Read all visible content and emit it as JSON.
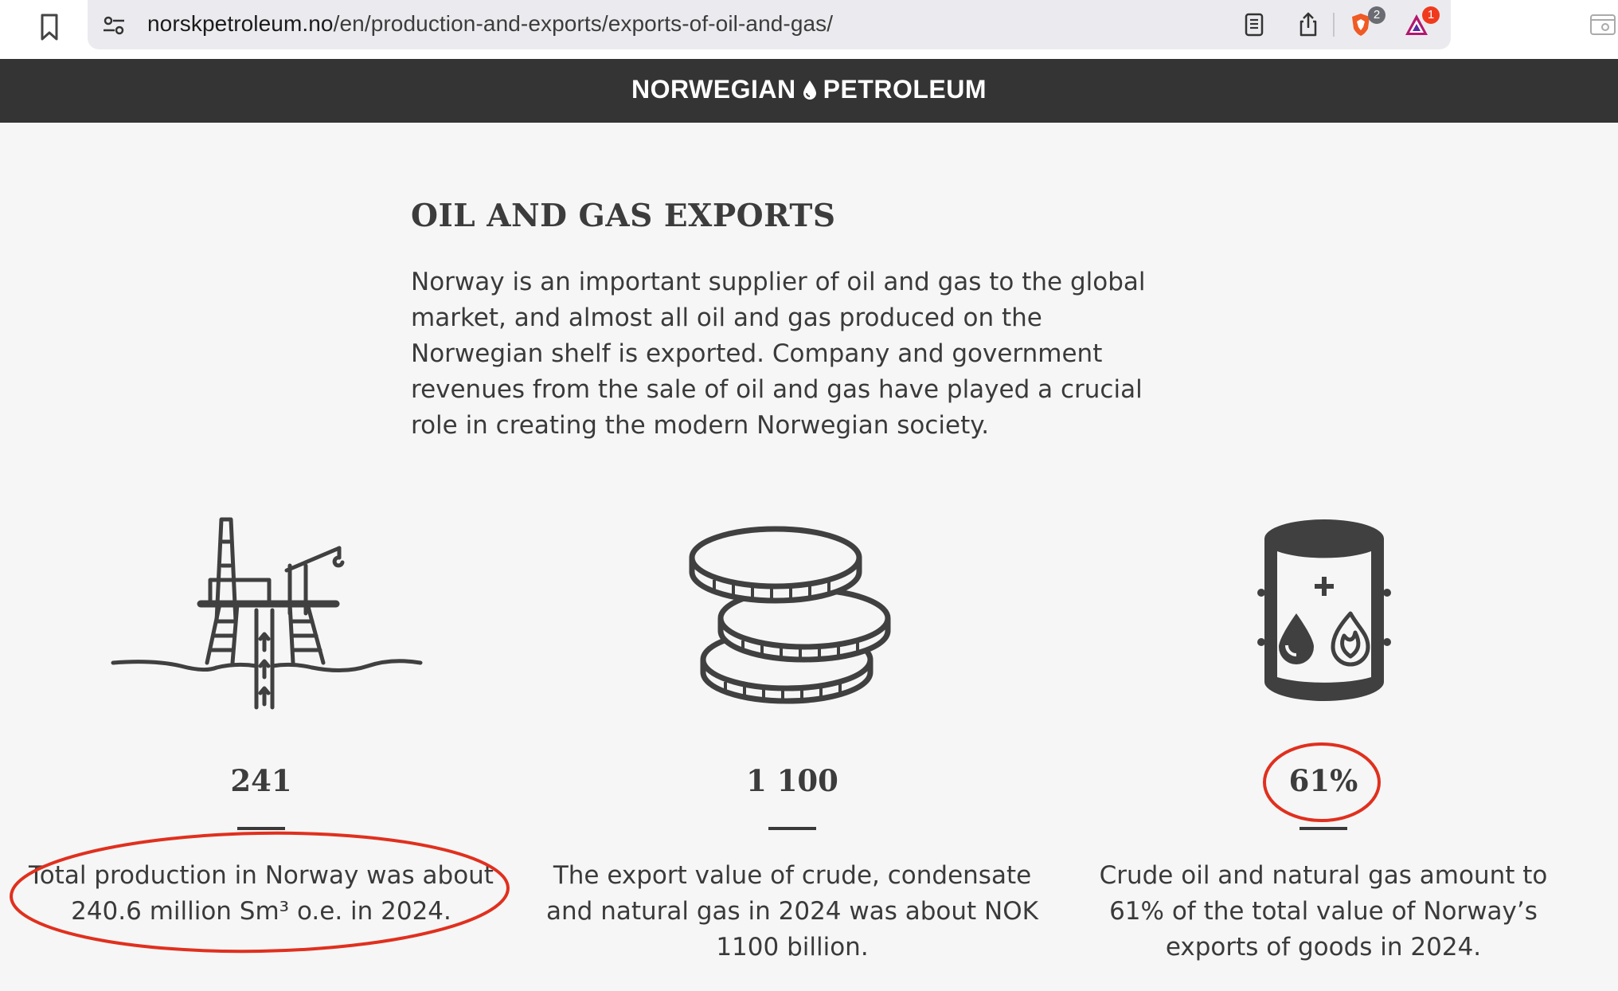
{
  "browser": {
    "url_host": "norskpetroleum.no",
    "url_path": "/en/production-and-exports/exports-of-oil-and-gas/",
    "shields_count": "2",
    "rewards_count": "1"
  },
  "header": {
    "logo_left": "NORWEGIAN",
    "logo_right": "PETROLEUM"
  },
  "main": {
    "title": "OIL AND GAS EXPORTS",
    "intro": "Norway is an important supplier of oil and gas to the global market, and almost all oil and gas produced on the Norwegian shelf is exported. Company and government revenues from the sale of oil and gas have played a crucial role in creating the modern Norwegian society."
  },
  "stats": [
    {
      "icon": "oil-platform-icon",
      "value": "241",
      "description": "Total production in Norway was about 240.6 million Sm³ o.e. in 2024."
    },
    {
      "icon": "coins-icon",
      "value": "1 100",
      "description": "The export value of crude, condensate and natural gas in 2024 was about NOK 1100 billion."
    },
    {
      "icon": "oil-gas-barrel-icon",
      "value": "61%",
      "description": "Crude oil and natural gas amount to 61% of the total value of Norway’s exports of goods in 2024."
    }
  ],
  "colors": {
    "header_bg": "#343434",
    "page_bg": "#f6f6f6",
    "annotation_red": "#e0301e"
  }
}
